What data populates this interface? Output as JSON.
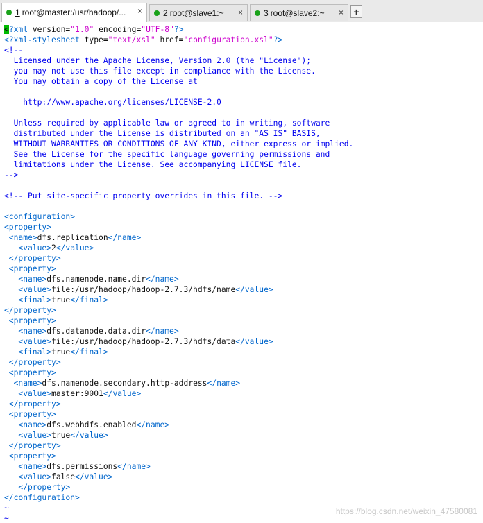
{
  "tabs": [
    {
      "num": "1",
      "title": "root@master:/usr/hadoop/...",
      "active": true
    },
    {
      "num": "2",
      "title": "root@slave1:~",
      "active": false
    },
    {
      "num": "3",
      "title": "root@slave2:~",
      "active": false
    }
  ],
  "tab_close_glyph": "×",
  "new_tab_glyph": "+",
  "status_color": "#1aa21a",
  "lines": [
    [
      [
        "cur",
        "<"
      ],
      [
        "t",
        "?xml "
      ],
      [
        "a",
        "version="
      ],
      [
        "v",
        "\"1.0\""
      ],
      [
        "a",
        " encoding="
      ],
      [
        "v",
        "\"UTF-8\""
      ],
      [
        "t",
        "?>"
      ]
    ],
    [
      [
        "t",
        "<?xml-stylesheet "
      ],
      [
        "a",
        "type="
      ],
      [
        "v",
        "\"text/xsl\""
      ],
      [
        "a",
        " href="
      ],
      [
        "v",
        "\"configuration.xsl\""
      ],
      [
        "t",
        "?>"
      ]
    ],
    [
      [
        "c",
        "<!--"
      ]
    ],
    [
      [
        "c",
        "  Licensed under the Apache License, Version 2.0 (the \"License\");"
      ]
    ],
    [
      [
        "c",
        "  you may not use this file except in compliance with the License."
      ]
    ],
    [
      [
        "c",
        "  You may obtain a copy of the License at"
      ]
    ],
    [
      [
        "c",
        ""
      ]
    ],
    [
      [
        "c",
        "    http://www.apache.org/licenses/LICENSE-2.0"
      ]
    ],
    [
      [
        "c",
        ""
      ]
    ],
    [
      [
        "c",
        "  Unless required by applicable law or agreed to in writing, software"
      ]
    ],
    [
      [
        "c",
        "  distributed under the License is distributed on an \"AS IS\" BASIS,"
      ]
    ],
    [
      [
        "c",
        "  WITHOUT WARRANTIES OR CONDITIONS OF ANY KIND, either express or implied."
      ]
    ],
    [
      [
        "c",
        "  See the License for the specific language governing permissions and"
      ]
    ],
    [
      [
        "c",
        "  limitations under the License. See accompanying LICENSE file."
      ]
    ],
    [
      [
        "c",
        "-->"
      ]
    ],
    [
      [
        "p",
        ""
      ]
    ],
    [
      [
        "c",
        "<!-- Put site-specific property overrides in this file. -->"
      ]
    ],
    [
      [
        "p",
        ""
      ]
    ],
    [
      [
        "t",
        "<configuration>"
      ]
    ],
    [
      [
        "t",
        "<property>"
      ]
    ],
    [
      [
        "t",
        " <name>"
      ],
      [
        "p",
        "dfs.replication"
      ],
      [
        "t",
        "</name>"
      ]
    ],
    [
      [
        "t",
        "   <value>"
      ],
      [
        "p",
        "2"
      ],
      [
        "t",
        "</value>"
      ]
    ],
    [
      [
        "t",
        " </property>"
      ]
    ],
    [
      [
        "t",
        " <property>"
      ]
    ],
    [
      [
        "t",
        "   <name>"
      ],
      [
        "p",
        "dfs.namenode.name.dir"
      ],
      [
        "t",
        "</name>"
      ]
    ],
    [
      [
        "t",
        "   <value>"
      ],
      [
        "p",
        "file:/usr/hadoop/hadoop-2.7.3/hdfs/name"
      ],
      [
        "t",
        "</value>"
      ]
    ],
    [
      [
        "t",
        "   <final>"
      ],
      [
        "p",
        "true"
      ],
      [
        "t",
        "</final>"
      ]
    ],
    [
      [
        "t",
        "</property>"
      ]
    ],
    [
      [
        "t",
        " <property>"
      ]
    ],
    [
      [
        "t",
        "   <name>"
      ],
      [
        "p",
        "dfs.datanode.data.dir"
      ],
      [
        "t",
        "</name>"
      ]
    ],
    [
      [
        "t",
        "   <value>"
      ],
      [
        "p",
        "file:/usr/hadoop/hadoop-2.7.3/hdfs/data"
      ],
      [
        "t",
        "</value>"
      ]
    ],
    [
      [
        "t",
        "   <final>"
      ],
      [
        "p",
        "true"
      ],
      [
        "t",
        "</final>"
      ]
    ],
    [
      [
        "t",
        " </property>"
      ]
    ],
    [
      [
        "t",
        " <property>"
      ]
    ],
    [
      [
        "t",
        "  <name>"
      ],
      [
        "p",
        "dfs.namenode.secondary.http-address"
      ],
      [
        "t",
        "</name>"
      ]
    ],
    [
      [
        "t",
        "   <value>"
      ],
      [
        "p",
        "master:9001"
      ],
      [
        "t",
        "</value>"
      ]
    ],
    [
      [
        "t",
        " </property>"
      ]
    ],
    [
      [
        "t",
        " <property>"
      ]
    ],
    [
      [
        "t",
        "   <name>"
      ],
      [
        "p",
        "dfs.webhdfs.enabled"
      ],
      [
        "t",
        "</name>"
      ]
    ],
    [
      [
        "t",
        "   <value>"
      ],
      [
        "p",
        "true"
      ],
      [
        "t",
        "</value>"
      ]
    ],
    [
      [
        "t",
        " </property>"
      ]
    ],
    [
      [
        "t",
        " <property>"
      ]
    ],
    [
      [
        "t",
        "   <name>"
      ],
      [
        "p",
        "dfs.permissions"
      ],
      [
        "t",
        "</name>"
      ]
    ],
    [
      [
        "t",
        "   <value>"
      ],
      [
        "p",
        "false"
      ],
      [
        "t",
        "</value>"
      ]
    ],
    [
      [
        "t",
        "   </property>"
      ]
    ],
    [
      [
        "t",
        "</configuration>"
      ]
    ],
    [
      [
        "tilde",
        "~"
      ]
    ],
    [
      [
        "tilde",
        "~"
      ]
    ]
  ],
  "watermark": "https://blog.csdn.net/weixin_47580081"
}
